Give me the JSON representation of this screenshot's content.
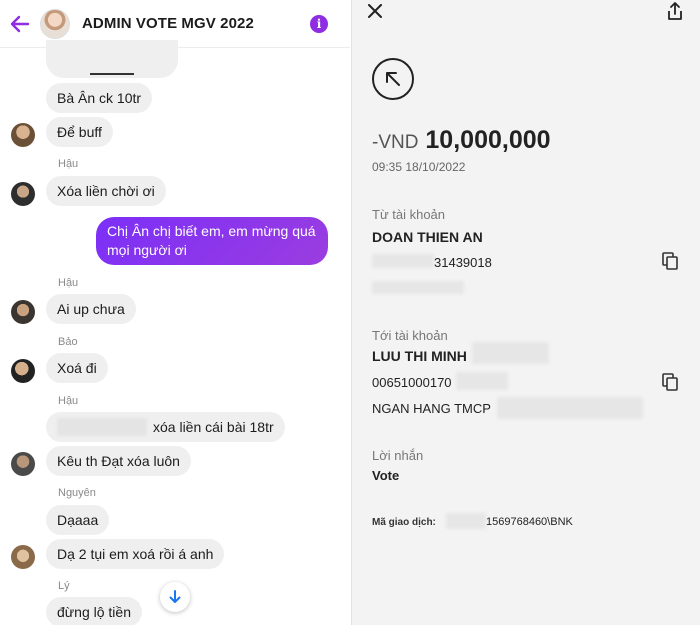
{
  "chat": {
    "title": "ADMIN VOTE MGV 2022",
    "info_label": "i",
    "messages": [
      {
        "text": "Bà Ân ck 10tr"
      },
      {
        "text": "Để buff"
      },
      {
        "text": "Xóa liền chời ơi"
      },
      {
        "text": "Chị Ân chị biết em, em mừng quá mọi người ơi",
        "line1": "Chị Ân chị biết em, em mừng quá",
        "line2": "mọi người ơi"
      },
      {
        "text": "Ai up chưa"
      },
      {
        "text": "Xoá đi"
      },
      {
        "text": "xóa liền cái bài 18tr"
      },
      {
        "text": "Kêu th Đạt xóa luôn"
      },
      {
        "text": "Dạaaa"
      },
      {
        "text": "Dạ 2 tụi em xoá rồi á anh"
      },
      {
        "text": "đừng lộ tiền"
      }
    ],
    "senders": {
      "hau1": "Hậu",
      "hau2": "Hậu",
      "bao": "Bảo",
      "hau3": "Hậu",
      "nguyen": "Nguyên",
      "ly": "Lý"
    },
    "accent_color": "#8e2de2"
  },
  "bank": {
    "amount_prefix": "-VND",
    "amount_value": "10,000,000",
    "datetime": "09:35 18/10/2022",
    "from_label": "Từ tài khoản",
    "from_name": "DOAN THIEN AN",
    "from_account_visible": "31439018",
    "to_label": "Tới tài khoản",
    "to_name": "LUU THI MINH",
    "to_account_visible": "00651000170",
    "to_bank": "NGAN HANG TMCP",
    "note_label": "Lời nhắn",
    "note_value": "Vote",
    "tx_code_label": "Mã giao dịch:",
    "tx_code_value": "1569768460\\BNK"
  }
}
